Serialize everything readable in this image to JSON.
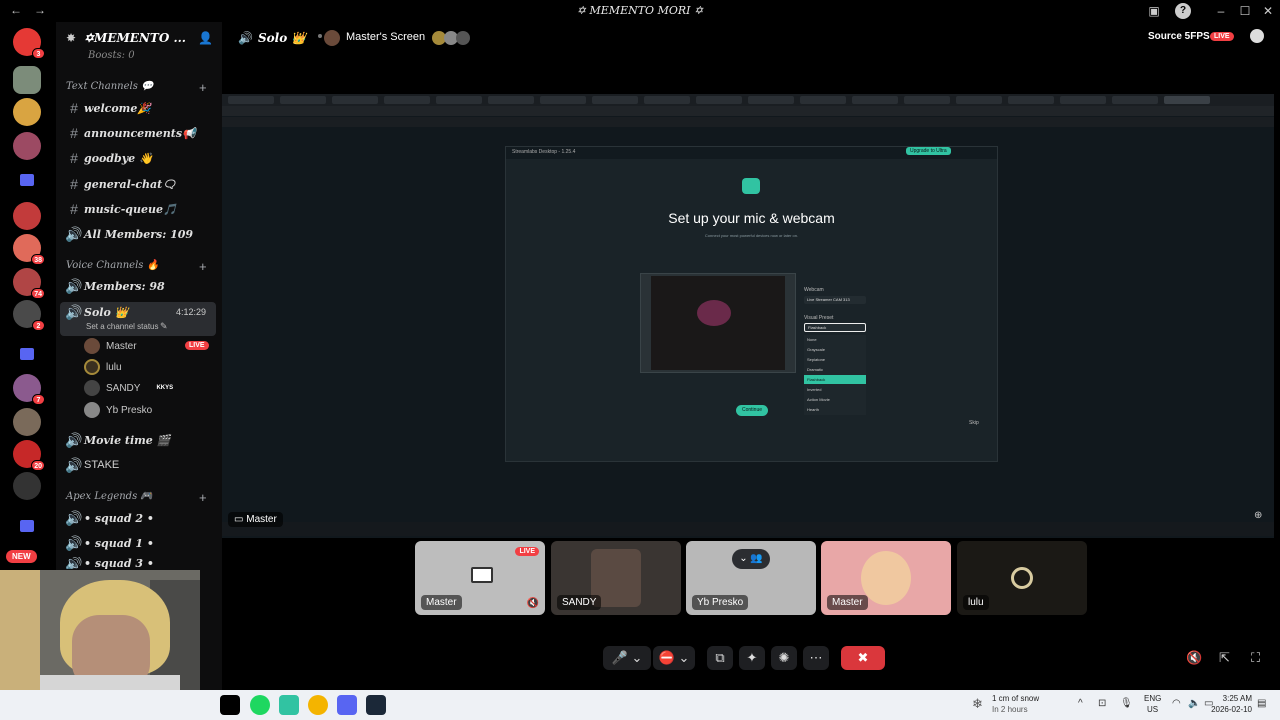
{
  "window": {
    "title": "✡ MEMENTO MORI ✡"
  },
  "colors": {
    "accent": "#23a55a",
    "live": "#f23f43",
    "hangup": "#da373c"
  },
  "server": {
    "name": "✡MEMENTO ...",
    "boosts": "Boosts: 0"
  },
  "sidebar": {
    "text_category": "Text Channels 💬",
    "text_channels": [
      "welcome🎉",
      "announcements📢",
      "goodbye 👋",
      "general-chat🗨",
      "music-queue🎵"
    ],
    "all_members": "All Members: 109",
    "voice_category": "Voice Channels 🔥",
    "members_count": "Members: 98",
    "active_voice": {
      "name": "Solo 👑",
      "time": "4:12:29",
      "status": "Set a channel status"
    },
    "voice_members": [
      {
        "name": "Master",
        "live": "LIVE"
      },
      {
        "name": "lulu"
      },
      {
        "name": "SANDY",
        "tag": "KKYS"
      },
      {
        "name": "Yb Presko"
      }
    ],
    "other_voice": [
      "Movie time 🎬",
      "STAKE"
    ],
    "apex_category": "Apex Legends 🎮",
    "apex_channels": [
      "• squad 2 •",
      "• squad 1 •",
      "• squad 3 •"
    ],
    "new_badge": "NEW"
  },
  "header": {
    "channel": "Solo 👑",
    "screen": "Master's Screen",
    "source": "Source 5FPS",
    "live": "LIVE"
  },
  "stream": {
    "heading": "Set up your mic & webcam",
    "subheading": "Connect your most powerful devices now or later on.",
    "webcam_label": "Webcam",
    "webcam_value": "Live Streamer CAM 313",
    "preset_label": "Visual Preset",
    "preset_value": "Flashback",
    "preset_options": [
      "None",
      "Grayscale",
      "Sepiatone",
      "Dramatic",
      "Flashback",
      "Inverted",
      "Action Movie",
      "Hearth"
    ],
    "continue": "Continue",
    "skip": "Skip",
    "app_title": "Streamlabs Desktop - 1.25.4",
    "upgrade": "Upgrade to Ultra",
    "overlay_name": "Master"
  },
  "tiles": [
    {
      "name": "Master",
      "live": "LIVE"
    },
    {
      "name": "SANDY"
    },
    {
      "name": "Yb Presko"
    },
    {
      "name": "Master"
    },
    {
      "name": "lulu"
    }
  ],
  "taskbar": {
    "weather": "1 cm of snow",
    "weather_sub": "In 2 hours",
    "lang": "ENG",
    "region": "US",
    "time": "3:25 AM",
    "date": "2026-02-10"
  }
}
